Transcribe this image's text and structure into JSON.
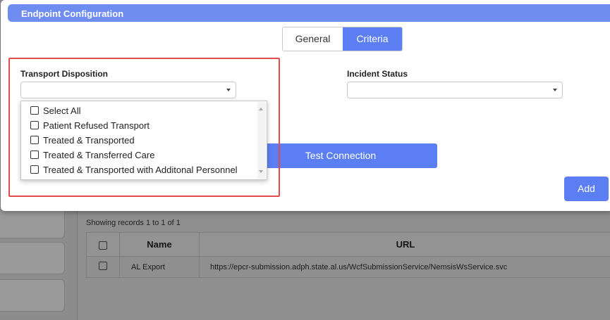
{
  "modal": {
    "title": "Endpoint Configuration",
    "tabs": [
      {
        "label": "General",
        "active": false
      },
      {
        "label": "Criteria",
        "active": true
      }
    ],
    "fields": {
      "transport_disposition": {
        "label": "Transport Disposition",
        "value": ""
      },
      "incident_status": {
        "label": "Incident Status",
        "value": ""
      }
    },
    "dropdown_options": [
      {
        "label": "Select All",
        "checked": false
      },
      {
        "label": "Patient Refused Transport",
        "checked": false
      },
      {
        "label": "Treated & Transported",
        "checked": false
      },
      {
        "label": "Treated & Transferred Care",
        "checked": false
      },
      {
        "label": "Treated & Transported with Additonal Personnel",
        "checked": false
      }
    ],
    "test_button": "Test Connection",
    "add_button": "Add"
  },
  "background": {
    "records_info": "Showing records 1 to 1 of 1",
    "table": {
      "columns": [
        "Name",
        "URL"
      ],
      "rows": [
        {
          "name": "AL Export",
          "url": "https://epcr-submission.adph.state.al.us/WcfSubmissionService/NemsisWsService.svc"
        }
      ]
    }
  },
  "colors": {
    "accent": "#5b7ff2",
    "header": "#6f8cf0",
    "highlight": "#e34c4c"
  }
}
